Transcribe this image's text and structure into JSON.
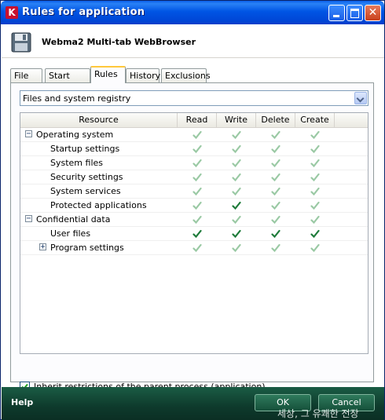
{
  "window": {
    "title": "Rules for application"
  },
  "header": {
    "app_name": "Webma2 Multi-tab WebBrowser"
  },
  "tabs": [
    {
      "label": "File",
      "active": false
    },
    {
      "label": "Start time",
      "active": false
    },
    {
      "label": "Rules",
      "active": true
    },
    {
      "label": "History",
      "active": false
    },
    {
      "label": "Exclusions",
      "active": false
    }
  ],
  "filter": {
    "selected": "Files and system registry"
  },
  "table": {
    "columns": [
      "Resource",
      "Read",
      "Write",
      "Delete",
      "Create"
    ],
    "rows": [
      {
        "label": "Operating system",
        "level": 0,
        "expander": "minus",
        "read": "inherited",
        "write": "inherited",
        "delete": "inherited",
        "create": "inherited"
      },
      {
        "label": "Startup settings",
        "level": 1,
        "read": "inherited",
        "write": "inherited",
        "delete": "inherited",
        "create": "inherited"
      },
      {
        "label": "System files",
        "level": 1,
        "read": "inherited",
        "write": "inherited",
        "delete": "inherited",
        "create": "inherited"
      },
      {
        "label": "Security settings",
        "level": 1,
        "read": "inherited",
        "write": "inherited",
        "delete": "inherited",
        "create": "inherited"
      },
      {
        "label": "System services",
        "level": 1,
        "read": "inherited",
        "write": "inherited",
        "delete": "inherited",
        "create": "inherited"
      },
      {
        "label": "Protected applications",
        "level": 1,
        "read": "inherited",
        "write": "allowed",
        "delete": "inherited",
        "create": "inherited"
      },
      {
        "label": "Confidential data",
        "level": 0,
        "expander": "minus",
        "read": "inherited",
        "write": "inherited",
        "delete": "inherited",
        "create": "inherited"
      },
      {
        "label": "User files",
        "level": 1,
        "read": "allowed",
        "write": "allowed",
        "delete": "allowed",
        "create": "allowed"
      },
      {
        "label": "Program settings",
        "level": 1,
        "expander": "plus",
        "read": "inherited",
        "write": "inherited",
        "delete": "inherited",
        "create": "inherited"
      }
    ]
  },
  "inherit": {
    "label": "Inherit restrictions of the parent process (application)",
    "checked": true
  },
  "footer": {
    "help": "Help",
    "ok": "OK",
    "cancel": "Cancel"
  },
  "watermark": "세상, 그 유쾌한 전장",
  "colors": {
    "allowed": "#1e7b3a",
    "inherited": "#9ac9a4",
    "titlebar": "#0055e4",
    "footer": "#0e3a2c"
  }
}
